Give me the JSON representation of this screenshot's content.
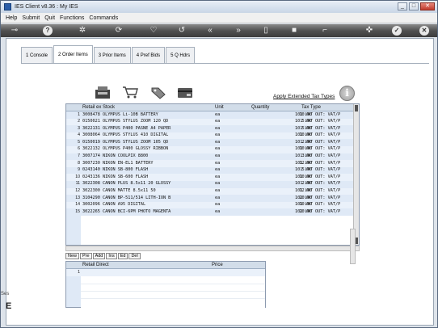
{
  "window": {
    "title": "IES Client v8.36 : My IES"
  },
  "menu": [
    "Help",
    "Submit",
    "Quit",
    "Functions",
    "Commands"
  ],
  "tabs": [
    {
      "label": "1 Console"
    },
    {
      "label": "2 Order Items"
    },
    {
      "label": "3 Prior Items"
    },
    {
      "label": "4 Pref Bids"
    },
    {
      "label": "5 Q Hdrs"
    }
  ],
  "ext_tax_link": "Apply Extended Tax Types",
  "items_grid": {
    "headers": {
      "stock": "Retail ex Stock",
      "unit": "Unit",
      "qty": "Quantity",
      "tax": "Tax Type"
    },
    "rows": [
      [
        "1",
        "3008478 OLYMPUS Li-10B BATTERY",
        "ea",
        "10.00",
        "101 VAT OUT: VAT/P"
      ],
      [
        "2",
        "0150021 OLYMPUS STYLUS ZOOM 120 QD",
        "ea",
        "5.00",
        "101 VAT OUT: VAT/P"
      ],
      [
        "3",
        "3022131 OLYMPUS P400 PASNE A4 PAPER",
        "ea",
        "5.00",
        "101 VAT OUT: VAT/P"
      ],
      [
        "4",
        "3008064 OLYMPUS STYLUS 410 DIGITAL",
        "ea",
        "10.00",
        "101 VAT OUT: VAT/P"
      ],
      [
        "5",
        "0150019 OLYMPUS STYLUS ZOOM 105 QD",
        "ea",
        "2.00",
        "101 VAT OUT: VAT/P"
      ],
      [
        "6",
        "3022132 OLYMPUS P400 GLOSSY RIBBON",
        "ea",
        "10.00",
        "101 VAT OUT: VAT/P"
      ],
      [
        "7",
        "3007174 NIKON COOLPIX 8800",
        "ea",
        "3.00",
        "101 VAT OUT: VAT/P"
      ],
      [
        "8",
        "3007230 NIKON EN-EL1 BATTERY",
        "ea",
        "12.00",
        "101 VAT OUT: VAT/P"
      ],
      [
        "9",
        "0243140 NIKON SB-800 FLASH",
        "ea",
        "5.00",
        "101 VAT OUT: VAT/P"
      ],
      [
        "10",
        "0243136 NIKON SB-600 FLASH",
        "ea",
        "10.00",
        "101 VAT OUT: VAT/P"
      ],
      [
        "11",
        "3022308 CANON PLUS 8.5x11 20 GLOSSY",
        "ea",
        "2.00",
        "101 VAT OUT: VAT/P"
      ],
      [
        "12",
        "3022300 CANON MATTE 8.5x11 50",
        "ea",
        "12.00",
        "101 VAT OUT: VAT/P"
      ],
      [
        "13",
        "3104290 CANON BP-511/514 LITH-ION B",
        "ea",
        "20.00",
        "101 VAT OUT: VAT/P"
      ],
      [
        "14",
        "3002096 CANON A95 DIGITAL",
        "ea",
        "10.00",
        "101 VAT OUT: VAT/P"
      ],
      [
        "15",
        "3022265 CANON BCI-6PM PHOTO MAGENTA",
        "ea",
        "20.00",
        "101 VAT OUT: VAT/P"
      ]
    ]
  },
  "row_buttons": [
    "New",
    "Pre",
    "Add",
    "Ins",
    "Ed",
    "Del"
  ],
  "direct_grid": {
    "headers": {
      "item": "Retail Direct",
      "price": "Price"
    },
    "rows": [
      [
        "1",
        "",
        ""
      ]
    ]
  },
  "side_text": "Ses",
  "colors": {
    "toolbar": "#3c3c3c",
    "grid": "#dfe9f6",
    "accent": "#2a5da8"
  }
}
